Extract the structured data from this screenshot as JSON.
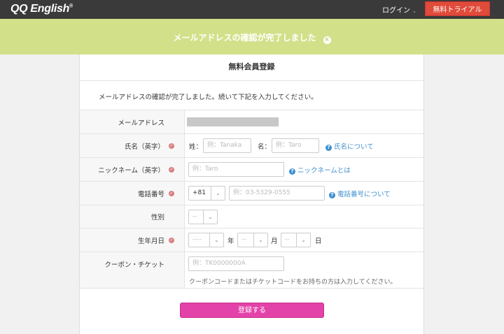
{
  "header": {
    "logo": "QQ English",
    "logo_mark": "®",
    "login": "ログイン",
    "trial_button": "無料トライアル"
  },
  "banner": {
    "message": "メールアドレスの確認が完了しました",
    "close_icon": "×"
  },
  "card": {
    "title": "無料会員登録",
    "intro": "メールアドレスの確認が完了しました。続いて下記を入力してください。"
  },
  "form": {
    "email": {
      "label": "メールアドレス"
    },
    "name": {
      "label": "氏名（英字）",
      "last_label": "姓：",
      "last_placeholder": "例：Tanaka",
      "first_label": "名：",
      "first_placeholder": "例：Taro",
      "help": "氏名について"
    },
    "nickname": {
      "label": "ニックネーム（英字）",
      "placeholder": "例：Taro",
      "help": "ニックネームとは"
    },
    "phone": {
      "label": "電話番号",
      "country_code": "+81",
      "placeholder": "例：03-5329-0555",
      "help": "電話番号について"
    },
    "gender": {
      "label": "性別",
      "value": "--"
    },
    "birthday": {
      "label": "生年月日",
      "year_value": "----",
      "year_unit": "年",
      "month_value": "--",
      "month_unit": "月",
      "day_value": "--",
      "day_unit": "日"
    },
    "coupon": {
      "label": "クーポン・チケット",
      "placeholder": "例：TK0000000A",
      "note": "クーポンコードまたはチケットコードをお持ちの方は入力してください。"
    },
    "submit": "登録する"
  },
  "colors": {
    "topbar": "#3a3a3a",
    "trial_button": "#e04b3a",
    "banner": "#d3e08a",
    "submit": "#e342a9",
    "link": "#3d8fd0",
    "required": "#d9807f"
  }
}
